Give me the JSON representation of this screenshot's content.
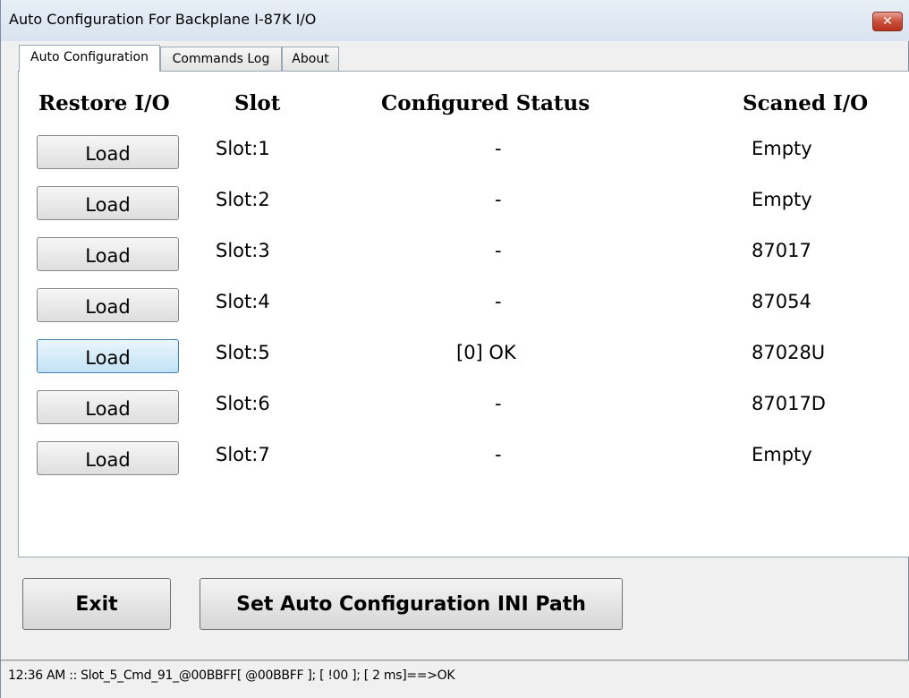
{
  "window": {
    "title": "Auto Configuration For Backplane I-87K I/O"
  },
  "tabs": [
    {
      "label": "Auto Configuration",
      "active": true
    },
    {
      "label": "Commands Log",
      "active": false
    },
    {
      "label": "About",
      "active": false
    }
  ],
  "table": {
    "headers": {
      "restore": "Restore I/O",
      "slot": "Slot",
      "status": "Configured Status",
      "scanned": "Scaned I/O"
    },
    "rows": [
      {
        "button": "Load",
        "slot": "Slot:1",
        "status": "-",
        "scanned": "Empty"
      },
      {
        "button": "Load",
        "slot": "Slot:2",
        "status": "-",
        "scanned": "Empty"
      },
      {
        "button": "Load",
        "slot": "Slot:3",
        "status": "-",
        "scanned": "87017"
      },
      {
        "button": "Load",
        "slot": "Slot:4",
        "status": "-",
        "scanned": "87054"
      },
      {
        "button": "Load",
        "slot": "Slot:5",
        "status": "[0] OK",
        "scanned": "87028U",
        "focused": true
      },
      {
        "button": "Load",
        "slot": "Slot:6",
        "status": "-",
        "scanned": "87017D"
      },
      {
        "button": "Load",
        "slot": "Slot:7",
        "status": "-",
        "scanned": "Empty"
      }
    ]
  },
  "buttons": {
    "exit": "Exit",
    "set_ini": "Set Auto Configuration INI Path"
  },
  "statusbar": {
    "text": "12:36 AM :: Slot_5_Cmd_91_@00BBFF[ @00BBFF ]; [ !00 ]; [ 2 ms]==>OK"
  }
}
